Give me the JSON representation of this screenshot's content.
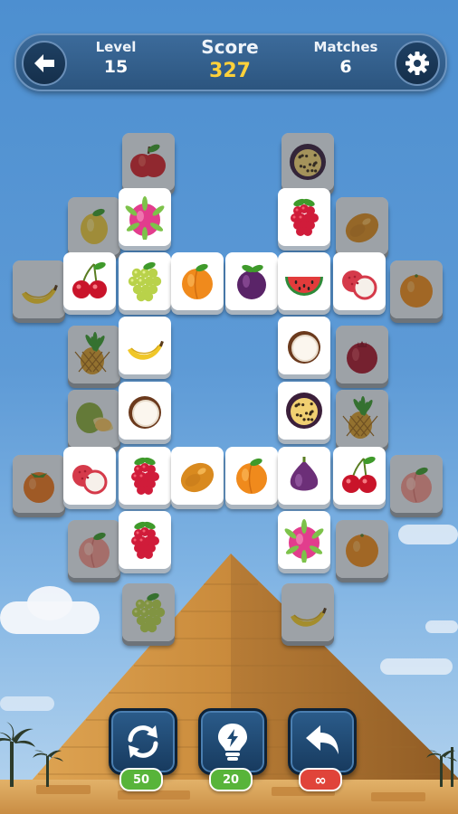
{
  "header": {
    "level_label": "Level",
    "level_value": "15",
    "score_label": "Score",
    "score_value": "327",
    "matches_label": "Matches",
    "matches_value": "6"
  },
  "colors": {
    "score_value": "#ffd13a",
    "hud_background": "#2f5a86",
    "tile_face": "#ffffff",
    "badge_green": "#58b43a",
    "badge_red": "#e0443a"
  },
  "tiles": [
    {
      "fruit": "apple",
      "state": "blocked"
    },
    {
      "fruit": "passion-fruit",
      "state": "blocked"
    },
    {
      "fruit": "lemon",
      "state": "blocked"
    },
    {
      "fruit": "dragon-fruit",
      "state": "free"
    },
    {
      "fruit": "raspberry",
      "state": "free"
    },
    {
      "fruit": "mango",
      "state": "blocked"
    },
    {
      "fruit": "banana",
      "state": "blocked"
    },
    {
      "fruit": "cherry",
      "state": "free"
    },
    {
      "fruit": "grapes",
      "state": "free"
    },
    {
      "fruit": "apricot",
      "state": "free"
    },
    {
      "fruit": "plum",
      "state": "free"
    },
    {
      "fruit": "watermelon",
      "state": "free"
    },
    {
      "fruit": "lychee",
      "state": "free"
    },
    {
      "fruit": "orange",
      "state": "blocked"
    },
    {
      "fruit": "pineapple",
      "state": "blocked"
    },
    {
      "fruit": "banana",
      "state": "free"
    },
    {
      "fruit": "coconut",
      "state": "free"
    },
    {
      "fruit": "pomegranate",
      "state": "blocked"
    },
    {
      "fruit": "guava",
      "state": "blocked"
    },
    {
      "fruit": "coconut",
      "state": "free"
    },
    {
      "fruit": "passion-fruit",
      "state": "free"
    },
    {
      "fruit": "pineapple",
      "state": "blocked"
    },
    {
      "fruit": "persimmon",
      "state": "blocked"
    },
    {
      "fruit": "lychee",
      "state": "free"
    },
    {
      "fruit": "raspberry",
      "state": "free"
    },
    {
      "fruit": "mango",
      "state": "free"
    },
    {
      "fruit": "apricot",
      "state": "free"
    },
    {
      "fruit": "fig",
      "state": "free"
    },
    {
      "fruit": "cherry",
      "state": "free"
    },
    {
      "fruit": "peach",
      "state": "blocked"
    },
    {
      "fruit": "peach",
      "state": "blocked"
    },
    {
      "fruit": "raspberry",
      "state": "free"
    },
    {
      "fruit": "dragon-fruit",
      "state": "free"
    },
    {
      "fruit": "orange",
      "state": "blocked"
    },
    {
      "fruit": "grapes",
      "state": "blocked"
    },
    {
      "fruit": "banana",
      "state": "blocked"
    }
  ],
  "powerups": [
    {
      "name": "shuffle",
      "icon": "shuffle-arrows-icon",
      "count": "50"
    },
    {
      "name": "hint",
      "icon": "lightbulb-icon",
      "count": "20"
    },
    {
      "name": "undo",
      "icon": "undo-arrow-icon",
      "count": "∞"
    }
  ]
}
